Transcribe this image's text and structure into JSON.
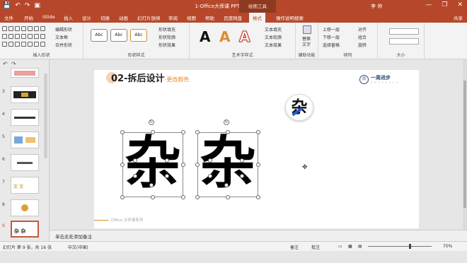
{
  "window": {
    "title": "1-Office大师课 PPT - PowerPoint",
    "context_tool": "绘图工具",
    "user": "李 帅",
    "min": "—",
    "restore": "❐",
    "close": "✕"
  },
  "qat": {
    "save": "💾",
    "undo": "↶",
    "redo": "↷",
    "present": "▣"
  },
  "tabs": [
    "文件",
    "开始",
    "iSlide",
    "插入",
    "设计",
    "切换",
    "动画",
    "幻灯片放映",
    "审阅",
    "视图",
    "帮助",
    "百度网盘",
    "格式",
    "操作说明搜索"
  ],
  "active_tab": "格式",
  "share": "共享",
  "ribbon": {
    "insert_shapes": {
      "label": "插入形状",
      "edit_shape": "编辑形状",
      "textbox": "文本框",
      "merge_shapes": "合并形状"
    },
    "shape_styles": {
      "label": "形状样式",
      "samples": [
        "Abc",
        "Abc",
        "Abc"
      ],
      "fill": "形状填充",
      "outline": "形状轮廓",
      "effects": "形状效果"
    },
    "wordart": {
      "label": "艺术字样式",
      "letters": [
        "A",
        "A",
        "A"
      ],
      "text_fill": "文本填充",
      "text_outline": "文本轮廓",
      "text_effects": "文本效果"
    },
    "accessibility": {
      "label": "辅助功能",
      "alt_text_1": "替换",
      "alt_text_2": "文字"
    },
    "arrange": {
      "label": "排列",
      "bring_forward": "上移一层",
      "send_backward": "下移一层",
      "selection_pane": "选择窗格",
      "align": "对齐",
      "group": "组合",
      "rotate": "旋转"
    },
    "size": {
      "label": "大小"
    }
  },
  "thumbnails": [
    {
      "num": "",
      "title": ""
    },
    {
      "num": "3",
      "title": ""
    },
    {
      "num": "4",
      "title": ""
    },
    {
      "num": "5",
      "title": ""
    },
    {
      "num": "6",
      "title": ""
    },
    {
      "num": "7",
      "title": "文 文"
    },
    {
      "num": "8",
      "title": ""
    },
    {
      "num": "9",
      "title": "杂 杂"
    }
  ],
  "slide": {
    "title_num": "02-",
    "title_main": "拆后设计",
    "title_sub": "-更改颜色",
    "logo_text": "一周进步",
    "logo_mark": "周",
    "badge_char": "杂",
    "big_char_1": "杂",
    "big_char_2": "杂",
    "footer": "Office 大师课系列"
  },
  "notes_placeholder": "单击此处添加备注",
  "status": {
    "slide_info": "幻灯片 第 9 张，共 16 张",
    "language": "中文(中国)",
    "notes_btn": "备注",
    "comments_btn": "批注",
    "zoom": "70%"
  },
  "colors": {
    "accent": "#b7472a",
    "orange": "#e08a2a"
  }
}
